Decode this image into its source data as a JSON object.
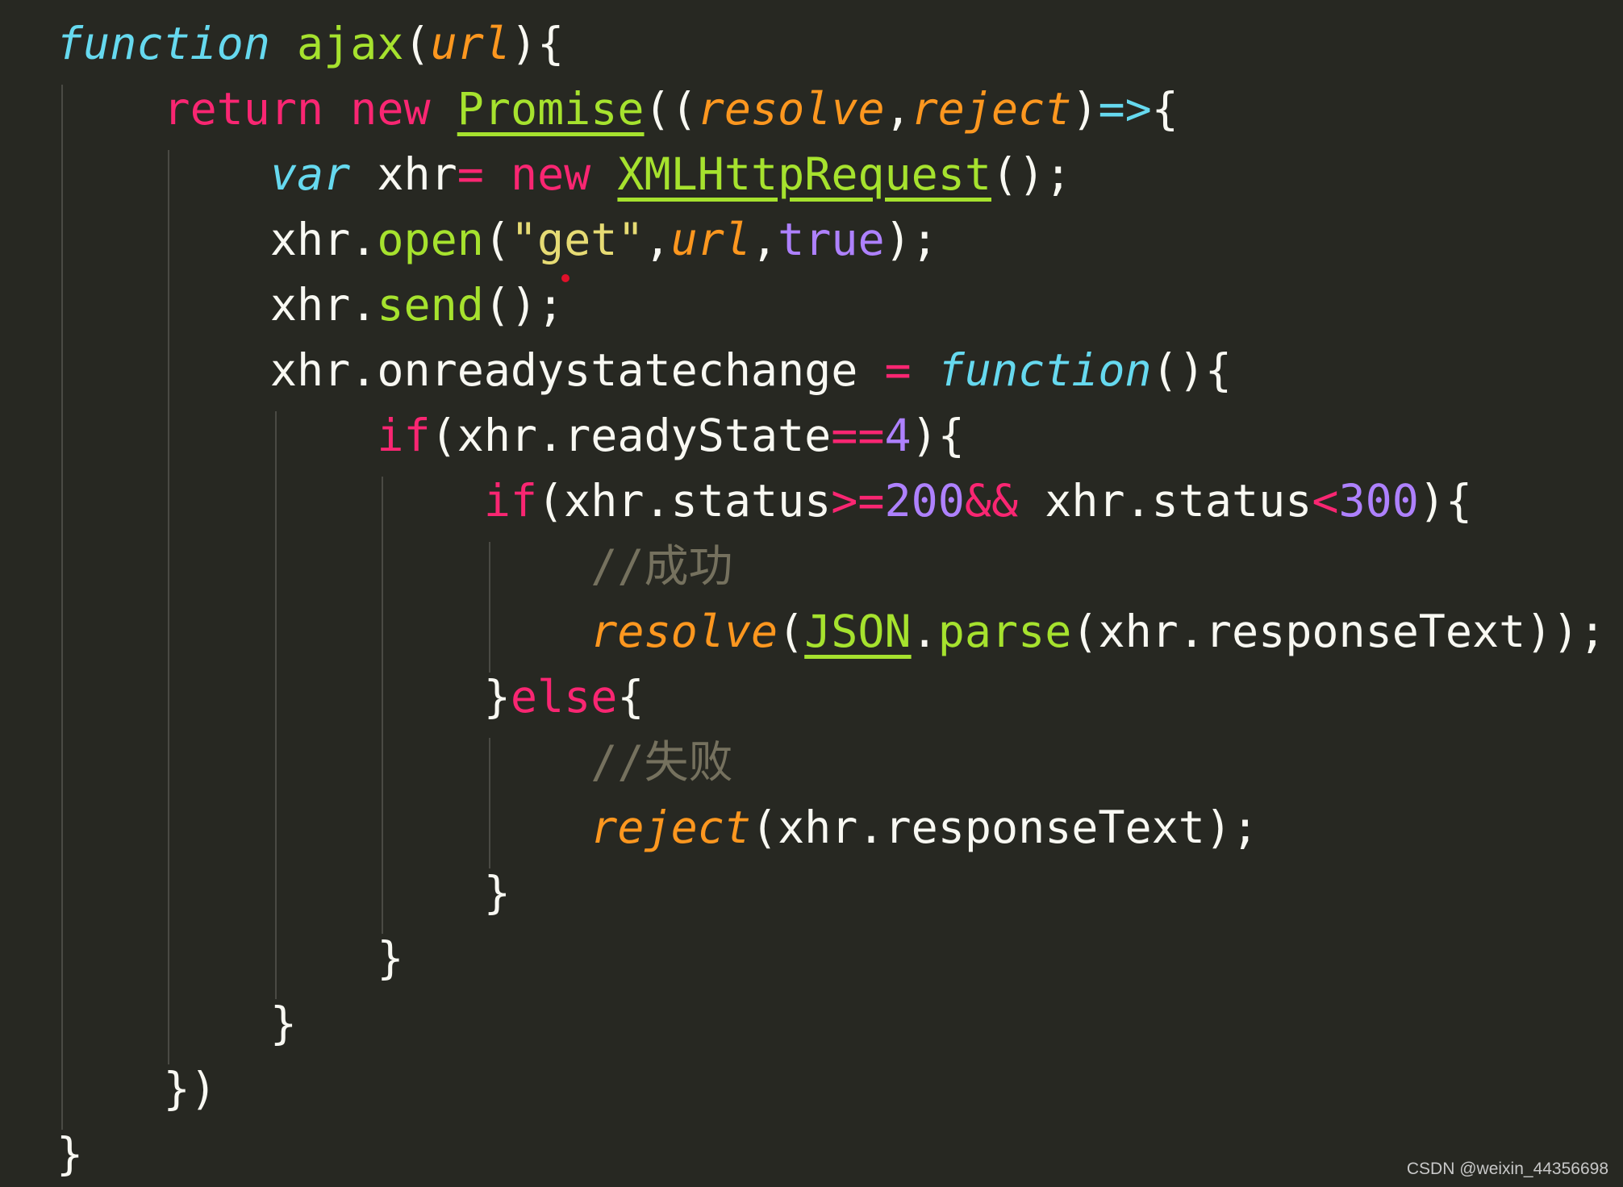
{
  "editor": {
    "theme_colors": {
      "background": "#272822",
      "keyword": "#f92672",
      "storage": "#66d9ef",
      "function_name": "#a6e22e",
      "parameter": "#fd971f",
      "number": "#ae81ff",
      "string": "#e6db74",
      "comment": "#75715e",
      "text": "#f8f8f2"
    },
    "lines": [
      [
        {
          "t": "function",
          "c": "kw-fn"
        },
        {
          "t": " "
        },
        {
          "t": "ajax",
          "c": "name"
        },
        {
          "t": "("
        },
        {
          "t": "url",
          "c": "param"
        },
        {
          "t": "){"
        }
      ],
      [
        {
          "t": "    "
        },
        {
          "t": "return",
          "c": "kw"
        },
        {
          "t": " "
        },
        {
          "t": "new",
          "c": "kw"
        },
        {
          "t": " "
        },
        {
          "t": "Promise",
          "c": "name ul"
        },
        {
          "t": "(("
        },
        {
          "t": "resolve",
          "c": "param"
        },
        {
          "t": ","
        },
        {
          "t": "reject",
          "c": "param"
        },
        {
          "t": ")"
        },
        {
          "t": "=>",
          "c": "kw-fn"
        },
        {
          "t": "{"
        }
      ],
      [
        {
          "t": "        "
        },
        {
          "t": "var",
          "c": "kw-fn"
        },
        {
          "t": " xhr"
        },
        {
          "t": "=",
          "c": "kw"
        },
        {
          "t": " "
        },
        {
          "t": "new",
          "c": "kw"
        },
        {
          "t": " "
        },
        {
          "t": "XMLHttpRequest",
          "c": "name ul"
        },
        {
          "t": "();"
        }
      ],
      [
        {
          "t": "        xhr."
        },
        {
          "t": "open",
          "c": "name"
        },
        {
          "t": "("
        },
        {
          "t": "\"get\"",
          "c": "str"
        },
        {
          "t": ","
        },
        {
          "t": "url",
          "c": "param"
        },
        {
          "t": ","
        },
        {
          "t": "true",
          "c": "num"
        },
        {
          "t": ");"
        }
      ],
      [
        {
          "t": "        xhr."
        },
        {
          "t": "send",
          "c": "name"
        },
        {
          "t": "();"
        }
      ],
      [
        {
          "t": "        xhr.onreadystatechange "
        },
        {
          "t": "=",
          "c": "kw"
        },
        {
          "t": " "
        },
        {
          "t": "function",
          "c": "kw-fn"
        },
        {
          "t": "(){"
        }
      ],
      [
        {
          "t": "            "
        },
        {
          "t": "if",
          "c": "kw"
        },
        {
          "t": "(xhr.readyState"
        },
        {
          "t": "==",
          "c": "kw"
        },
        {
          "t": "4",
          "c": "num"
        },
        {
          "t": "){"
        }
      ],
      [
        {
          "t": "                "
        },
        {
          "t": "if",
          "c": "kw"
        },
        {
          "t": "(xhr.status"
        },
        {
          "t": ">=",
          "c": "kw"
        },
        {
          "t": "200",
          "c": "num"
        },
        {
          "t": "&&",
          "c": "kw"
        },
        {
          "t": " xhr.status"
        },
        {
          "t": "<",
          "c": "kw"
        },
        {
          "t": "300",
          "c": "num"
        },
        {
          "t": "){"
        }
      ],
      [
        {
          "t": "                    "
        },
        {
          "t": "//成功",
          "c": "cmt"
        }
      ],
      [
        {
          "t": "                    "
        },
        {
          "t": "resolve",
          "c": "param"
        },
        {
          "t": "("
        },
        {
          "t": "JSON",
          "c": "name ul"
        },
        {
          "t": "."
        },
        {
          "t": "parse",
          "c": "name"
        },
        {
          "t": "(xhr.responseText));"
        }
      ],
      [
        {
          "t": "                }"
        },
        {
          "t": "else",
          "c": "kw"
        },
        {
          "t": "{"
        }
      ],
      [
        {
          "t": "                    "
        },
        {
          "t": "//失败",
          "c": "cmt"
        }
      ],
      [
        {
          "t": "                    "
        },
        {
          "t": "reject",
          "c": "param"
        },
        {
          "t": "(xhr.responseText);"
        }
      ],
      [
        {
          "t": "                }"
        }
      ],
      [
        {
          "t": "            }"
        }
      ],
      [
        {
          "t": "        }"
        }
      ],
      [
        {
          "t": "    })"
        }
      ],
      [
        {
          "t": "}"
        }
      ]
    ]
  },
  "watermark": "CSDN @weixin_44356698"
}
